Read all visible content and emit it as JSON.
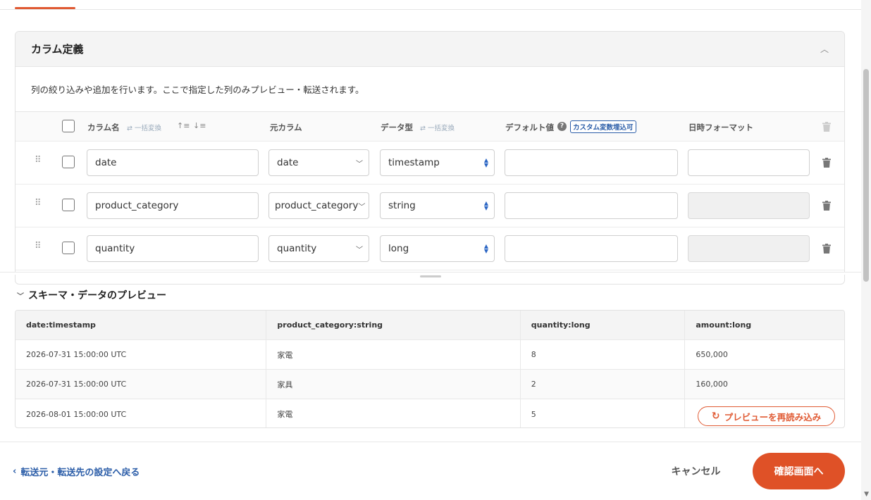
{
  "panel": {
    "title": "カラム定義",
    "description": "列の絞り込みや追加を行います。ここで指定した列のみプレビュー・転送されます。"
  },
  "columns_table": {
    "headers": {
      "column_name": "カラム名",
      "bulk_convert": "⇄ 一括変換",
      "source_column": "元カラム",
      "data_type": "データ型",
      "default_value": "デフォルト値",
      "custom_var_badge": "カスタム変数埋込可",
      "date_format": "日時フォーマット"
    },
    "rows": [
      {
        "name": "date",
        "source": "date",
        "type": "timestamp",
        "default": "",
        "format": "",
        "format_disabled": false
      },
      {
        "name": "product_category",
        "source": "product_category",
        "type": "string",
        "default": "",
        "format": "",
        "format_disabled": true
      },
      {
        "name": "quantity",
        "source": "quantity",
        "type": "long",
        "default": "",
        "format": "",
        "format_disabled": true
      }
    ]
  },
  "preview": {
    "title": "スキーマ・データのプレビュー",
    "headers": [
      "date:timestamp",
      "product_category:string",
      "quantity:long",
      "amount:long"
    ],
    "rows": [
      [
        "2026-07-31 15:00:00 UTC",
        "家電",
        "8",
        "650,000"
      ],
      [
        "2026-07-31 15:00:00 UTC",
        "家具",
        "2",
        "160,000"
      ],
      [
        "2026-08-01 15:00:00 UTC",
        "家電",
        "5",
        ""
      ]
    ],
    "reload_label": "プレビューを再読み込み"
  },
  "footer": {
    "back_label": "転送元・転送先の設定へ戻る",
    "cancel_label": "キャンセル",
    "confirm_label": "確認画面へ"
  },
  "colors": {
    "accent": "#df5127",
    "link": "#2b5da8"
  }
}
